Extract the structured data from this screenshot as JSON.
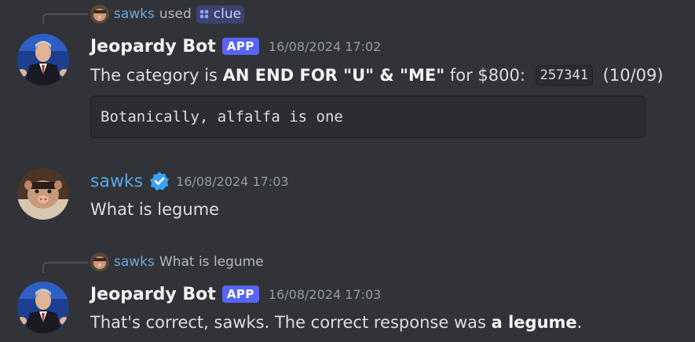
{
  "colors": {
    "background": "#313338",
    "app_badge": "#5865f2",
    "username_blue": "#5ba4e5",
    "verified_badge": "#3ba3f5"
  },
  "messages": [
    {
      "reply": {
        "user": "sawks",
        "action": "used",
        "command_icon": "slash-command-icon",
        "command": "clue"
      },
      "author": "Jeopardy Bot",
      "badge": "APP",
      "timestamp": "16/08/2024 17:02",
      "text_prefix": "The category is ",
      "text_bold": "AN END FOR \"U\" & \"ME\"",
      "text_middle": " for $800: ",
      "code": "257341",
      "text_suffix": " (10/09)",
      "code_block": "Botanically, alfalfa is one"
    },
    {
      "author": "sawks",
      "verified_icon": "verified-badge-icon",
      "timestamp": "16/08/2024 17:03",
      "text": "What is legume"
    },
    {
      "reply": {
        "user": "sawks",
        "text": "What is legume"
      },
      "author": "Jeopardy Bot",
      "badge": "APP",
      "timestamp": "16/08/2024 17:03",
      "text_prefix": "That's correct, sawks. The correct response was ",
      "text_bold": "a legume",
      "text_suffix": "."
    }
  ]
}
